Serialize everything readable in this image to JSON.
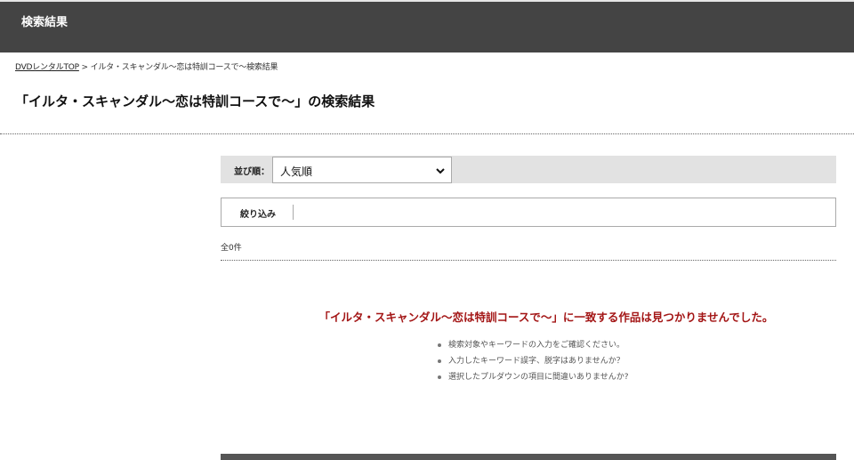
{
  "header": {
    "title": "検索結果"
  },
  "breadcrumb": {
    "home": "DVDレンタルTOP",
    "separator": ">",
    "current": "イルタ・スキャンダル〜恋は特訓コースで〜検索結果"
  },
  "page_title": "「イルタ・スキャンダル〜恋は特訓コースで〜」の検索結果",
  "sort": {
    "label": "並び順：",
    "selected": "人気順",
    "icon": "chevron-down-icon"
  },
  "filter": {
    "label": "絞り込み"
  },
  "results": {
    "count": "全0件",
    "no_result_message": "「イルタ・スキャンダル〜恋は特訓コースで〜」に一致する作品は見つかりませんでした。",
    "tips": [
      "検索対象やキーワードの入力をご確認ください。",
      "入力したキーワード誤字、脱字はありませんか？",
      "選択したプルダウンの項目に間違いありませんか?"
    ]
  },
  "colors": {
    "header_bg": "#444444",
    "sort_bar_bg": "#e2e2e2",
    "error_text": "#a31515"
  }
}
